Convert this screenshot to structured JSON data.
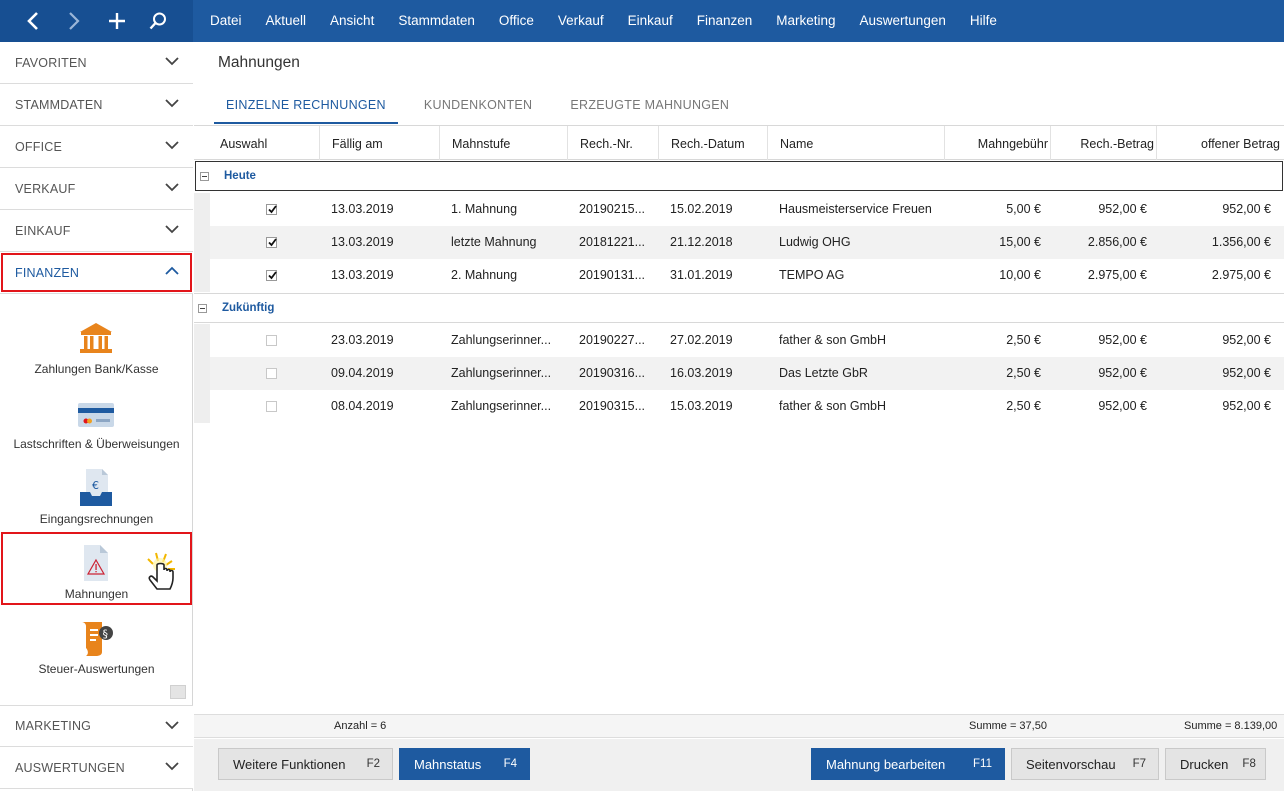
{
  "menu": [
    "Datei",
    "Aktuell",
    "Ansicht",
    "Stammdaten",
    "Office",
    "Verkauf",
    "Einkauf",
    "Finanzen",
    "Marketing",
    "Auswertungen",
    "Hilfe"
  ],
  "sidebar": {
    "sections_top": [
      "FAVORITEN",
      "STAMMDATEN",
      "OFFICE",
      "VERKAUF",
      "EINKAUF"
    ],
    "active_section": "FINANZEN",
    "sub_items": [
      "Zahlungen Bank/Kasse",
      "Lastschriften & Überweisungen",
      "Eingangsrechnungen",
      "Mahnungen",
      "Steuer-Auswertungen"
    ],
    "sections_bottom": [
      "MARKETING",
      "AUSWERTUNGEN"
    ]
  },
  "page": {
    "title": "Mahnungen",
    "tabs": [
      "EINZELNE RECHNUNGEN",
      "KUNDENKONTEN",
      "ERZEUGTE MAHNUNGEN"
    ],
    "active_tab": 0
  },
  "table": {
    "columns": [
      "Auswahl",
      "Fällig am",
      "Mahnstufe",
      "Rech.-Nr.",
      "Rech.-Datum",
      "Name",
      "Mahngebühr",
      "Rech.-Betrag",
      "offener Betrag"
    ],
    "groups": [
      {
        "label": "Heute",
        "rows": [
          {
            "checked": true,
            "faellig": "13.03.2019",
            "stufe": "1. Mahnung",
            "nr": "20190215...",
            "datum": "15.02.2019",
            "name": "Hausmeisterservice Freuen",
            "gebuehr": "5,00 €",
            "betrag": "952,00 €",
            "offen": "952,00 €"
          },
          {
            "checked": true,
            "faellig": "13.03.2019",
            "stufe": "letzte Mahnung",
            "nr": "20181221...",
            "datum": "21.12.2018",
            "name": "Ludwig OHG",
            "gebuehr": "15,00 €",
            "betrag": "2.856,00 €",
            "offen": "1.356,00 €"
          },
          {
            "checked": true,
            "faellig": "13.03.2019",
            "stufe": "2. Mahnung",
            "nr": "20190131...",
            "datum": "31.01.2019",
            "name": "TEMPO AG",
            "gebuehr": "10,00 €",
            "betrag": "2.975,00 €",
            "offen": "2.975,00 €"
          }
        ]
      },
      {
        "label": "Zukünftig",
        "rows": [
          {
            "checked": false,
            "faellig": "23.03.2019",
            "stufe": "Zahlungserinner...",
            "nr": "20190227...",
            "datum": "27.02.2019",
            "name": "father & son GmbH",
            "gebuehr": "2,50 €",
            "betrag": "952,00 €",
            "offen": "952,00 €"
          },
          {
            "checked": false,
            "faellig": "09.04.2019",
            "stufe": "Zahlungserinner...",
            "nr": "20190316...",
            "datum": "16.03.2019",
            "name": "Das Letzte GbR",
            "gebuehr": "2,50 €",
            "betrag": "952,00 €",
            "offen": "952,00 €"
          },
          {
            "checked": false,
            "faellig": "08.04.2019",
            "stufe": "Zahlungserinner...",
            "nr": "20190315...",
            "datum": "15.03.2019",
            "name": "father & son GmbH",
            "gebuehr": "2,50 €",
            "betrag": "952,00 €",
            "offen": "952,00 €"
          }
        ]
      }
    ]
  },
  "footer": {
    "count": "Anzahl = 6",
    "sum_fee": "Summe = 37,50",
    "sum_open": "Summe = 8.139,00"
  },
  "buttons": {
    "weitere": {
      "label": "Weitere Funktionen",
      "key": "F2"
    },
    "mahnstatus": {
      "label": "Mahnstatus",
      "key": "F4"
    },
    "bearbeiten": {
      "label": "Mahnung bearbeiten",
      "key": "F11"
    },
    "vorschau": {
      "label": "Seitenvorschau",
      "key": "F7"
    },
    "drucken": {
      "label": "Drucken",
      "key": "F8"
    }
  },
  "colors": {
    "accent": "#1e5aa0",
    "highlight": "#e2151a"
  },
  "icons": [
    "back-arrow-icon",
    "forward-arrow-icon",
    "plus-icon",
    "search-icon",
    "chevron-down-icon",
    "chevron-up-icon",
    "bank-icon",
    "card-icon",
    "invoice-tray-icon",
    "warning-document-icon",
    "tax-scroll-icon",
    "hand-pointer-icon"
  ]
}
